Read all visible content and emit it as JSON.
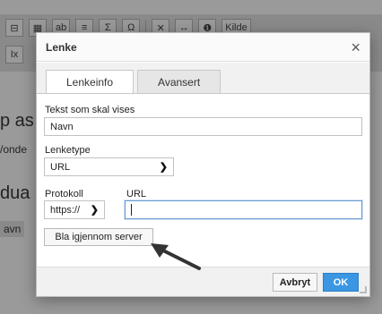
{
  "background": {
    "toolbar_row1": [
      "⊟",
      "▦",
      "ab",
      "≡",
      "Σ",
      "Ω",
      "✕",
      "↔",
      "❶",
      "Kilde"
    ],
    "toolbar_row2_icon": "Ix",
    "text_lines": [
      "p as",
      "/onde",
      "dua",
      "avn"
    ]
  },
  "dialog": {
    "title": "Lenke",
    "tabs": [
      {
        "label": "Lenkeinfo",
        "active": true
      },
      {
        "label": "Avansert",
        "active": false
      }
    ],
    "fields": {
      "display_text_label": "Tekst som skal vises",
      "display_text_value": "Navn",
      "link_type_label": "Lenketype",
      "link_type_value": "URL",
      "protocol_label": "Protokoll",
      "protocol_value": "https://",
      "url_label": "URL",
      "url_value": ""
    },
    "browse_button": "Bla igjennom server",
    "cancel_button": "Avbryt",
    "ok_button": "OK"
  },
  "colors": {
    "accent": "#3b97e3",
    "overlay": "#9a9a9a"
  }
}
